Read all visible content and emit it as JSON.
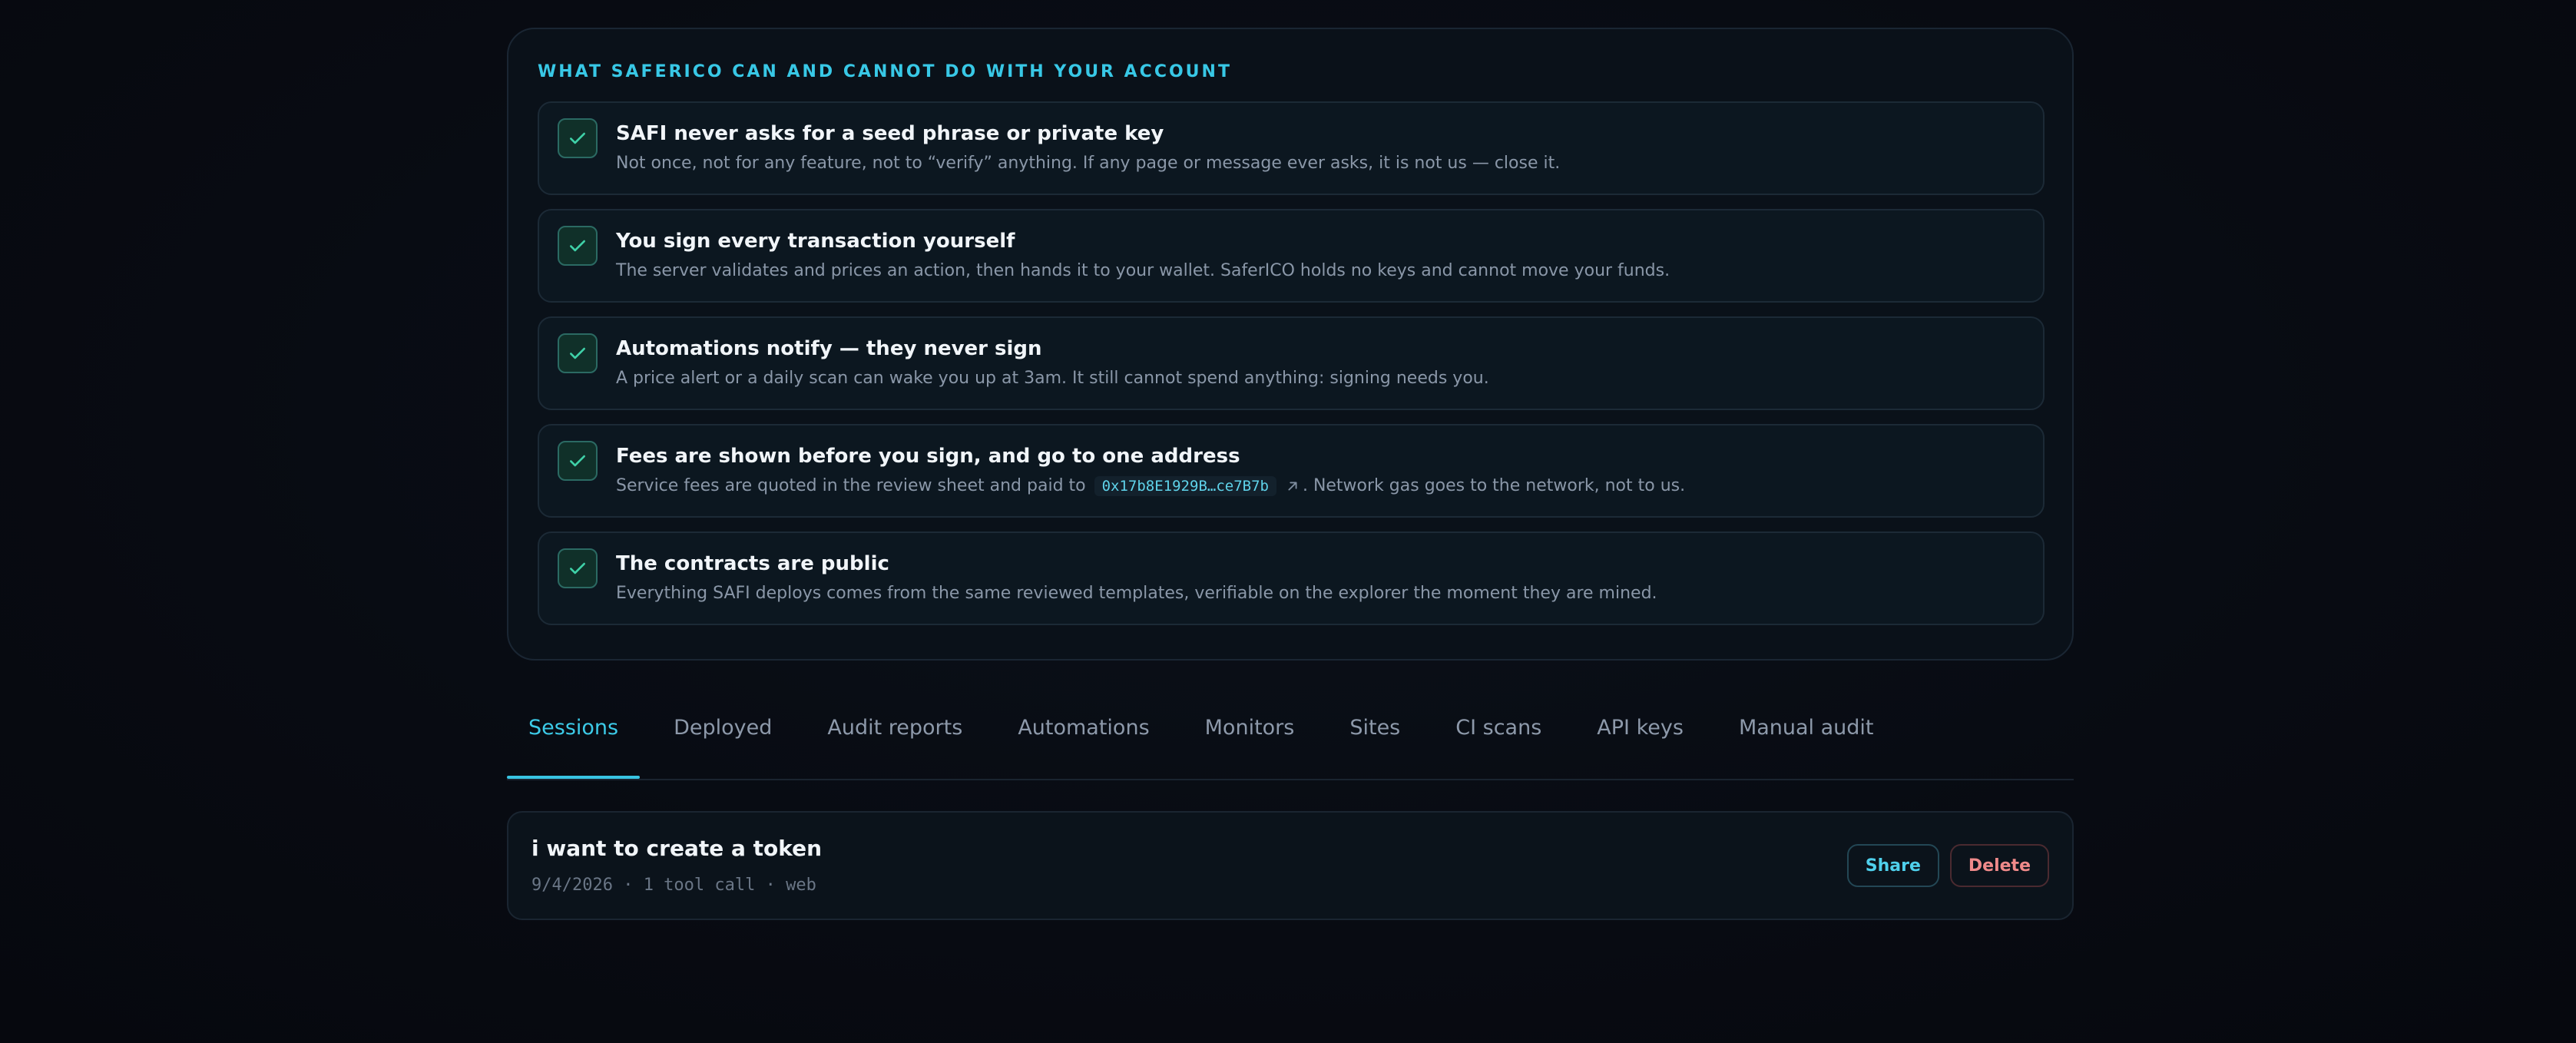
{
  "safety": {
    "heading": "WHAT SAFERICO CAN AND CANNOT DO WITH YOUR ACCOUNT",
    "rules": [
      {
        "title": "SAFI never asks for a seed phrase or private key",
        "desc": "Not once, not for any feature, not to “verify” anything. If any page or message ever asks, it is not us — close it."
      },
      {
        "title": "You sign every transaction yourself",
        "desc": "The server validates and prices an action, then hands it to your wallet. SaferICO holds no keys and cannot move your funds."
      },
      {
        "title": "Automations notify — they never sign",
        "desc": "A price alert or a daily scan can wake you up at 3am. It still cannot spend anything: signing needs you."
      },
      {
        "title": "Fees are shown before you sign, and go to one address",
        "desc_before": "Service fees are quoted in the review sheet and paid to",
        "address": "0x17b8E1929B…ce7B7b",
        "desc_after": ". Network gas goes to the network, not to us."
      },
      {
        "title": "The contracts are public",
        "desc": "Everything SAFI deploys comes from the same reviewed templates, verifiable on the explorer the moment they are mined."
      }
    ]
  },
  "tabs": {
    "items": [
      {
        "label": "Sessions",
        "active": true
      },
      {
        "label": "Deployed"
      },
      {
        "label": "Audit reports"
      },
      {
        "label": "Automations"
      },
      {
        "label": "Monitors"
      },
      {
        "label": "Sites"
      },
      {
        "label": "CI scans"
      },
      {
        "label": "API keys"
      },
      {
        "label": "Manual audit"
      }
    ]
  },
  "session": {
    "title": "i want to create a token",
    "meta": "9/4/2026 · 1 tool call · web",
    "share_label": "Share",
    "delete_label": "Delete"
  },
  "colors": {
    "accent": "#38c8e6",
    "check": "#3fd1a8",
    "danger": "#ef8a8a"
  },
  "icons": {
    "check": "check-icon",
    "external_link": "external-link-icon"
  }
}
